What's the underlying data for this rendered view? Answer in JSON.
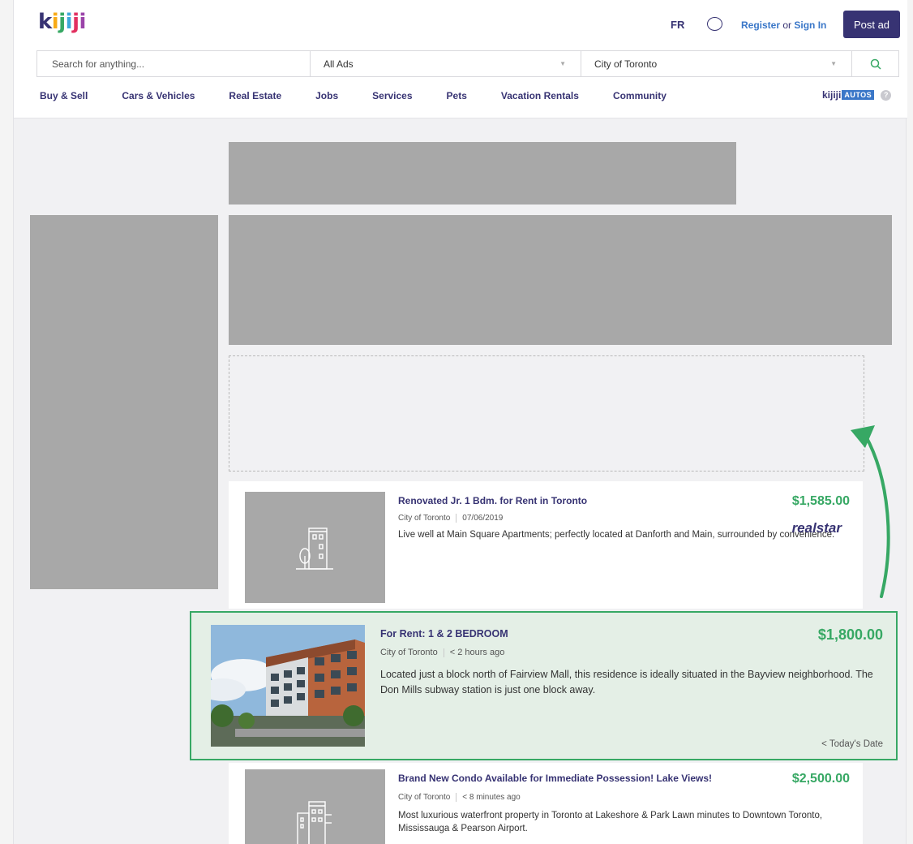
{
  "header": {
    "logo": {
      "k": "k",
      "i1": "i",
      "j1": "j",
      "i2": "i",
      "j2": "j",
      "i3": "i"
    },
    "lang": "FR",
    "register": "Register",
    "or": "or",
    "sign_in": "Sign In",
    "post_ad": "Post ad"
  },
  "search": {
    "placeholder": "Search for anything...",
    "category": "All Ads",
    "location": "City of Toronto"
  },
  "nav": {
    "items": [
      "Buy & Sell",
      "Cars & Vehicles",
      "Real Estate",
      "Jobs",
      "Services",
      "Pets",
      "Vacation Rentals",
      "Community"
    ],
    "autos_brand": "kijiji",
    "autos_badge": "AUTOS",
    "help": "?"
  },
  "listings": [
    {
      "title": "Renovated Jr. 1 Bdm. for Rent in Toronto",
      "location": "City of Toronto",
      "date": "07/06/2019",
      "description": "Live well at Main Square Apartments; perfectly located at Danforth and Main, surrounded by convenience.",
      "price": "$1,585.00",
      "advertiser": "realstar"
    },
    {
      "title": "For Rent: 1 & 2 BEDROOM",
      "location": "City of Toronto",
      "date": "< 2 hours ago",
      "description": "Located just a block north of Fairview Mall, this residence is ideally situated in the Bayview neighborhood. The Don Mills subway station is just one block away.",
      "price": "$1,800.00",
      "posted_label": "< Today's Date"
    },
    {
      "title": "Brand New Condo Available for Immediate Possession! Lake Views!",
      "location": "City of Toronto",
      "date": "< 8 minutes ago",
      "description": "Most luxurious waterfront property in Toronto at Lakeshore & Park Lawn minutes to Downtown Toronto, Mississauga & Pearson Airport.",
      "price": "$2,500.00"
    }
  ],
  "colors": {
    "brand": "#373373",
    "price": "#37a864",
    "highlight_border": "#37a864",
    "highlight_bg": "#e4efe6",
    "placeholder": "#a8a8a8",
    "link": "#3a77c8"
  }
}
